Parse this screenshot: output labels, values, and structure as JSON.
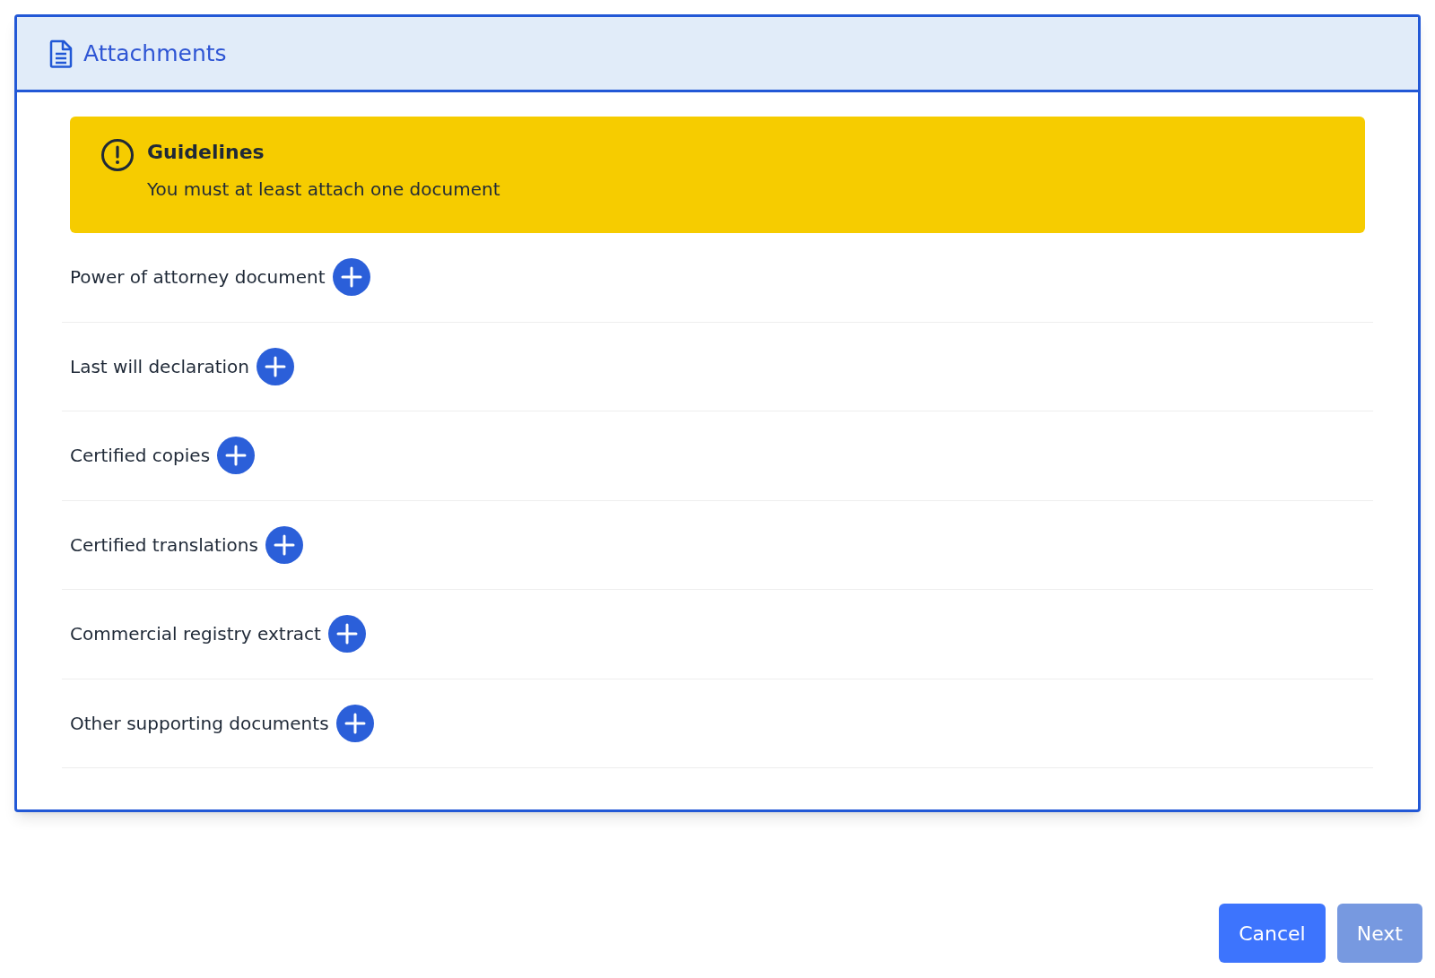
{
  "panel": {
    "title": "Attachments"
  },
  "guidelines": {
    "title": "Guidelines",
    "text": "You must at least attach one document"
  },
  "attachments": [
    {
      "label": "Power of attorney document"
    },
    {
      "label": "Last will declaration"
    },
    {
      "label": "Certified copies"
    },
    {
      "label": "Certified translations"
    },
    {
      "label": "Commercial registry extract"
    },
    {
      "label": "Other supporting documents"
    }
  ],
  "buttons": [
    {
      "label": "Cancel",
      "disabled": false
    },
    {
      "label": "Next",
      "disabled": true
    }
  ]
}
